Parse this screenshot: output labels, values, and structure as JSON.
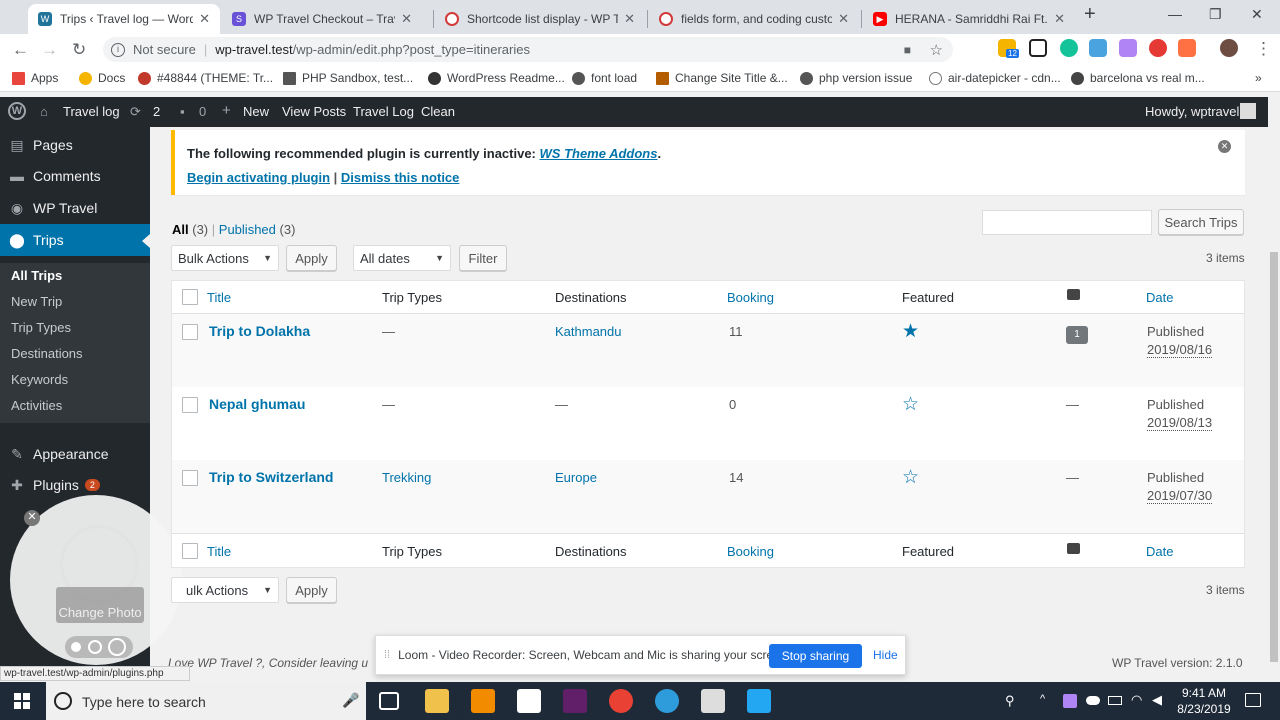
{
  "browser": {
    "tabs": [
      {
        "title": "Trips ‹ Travel log — WordPress",
        "active": true,
        "color": "#21759b"
      },
      {
        "title": "WP Travel Checkout – Travel lo",
        "active": false,
        "color": "#6a52d8"
      },
      {
        "title": "Shortcode list display - WP Tra",
        "active": false,
        "color": "#d23a3a"
      },
      {
        "title": "fields form, and coding custom",
        "active": false,
        "color": "#d23a3a"
      },
      {
        "title": "HERANA - Samriddhi Rai Ft. Ro",
        "active": false,
        "color": "#ff0000"
      }
    ],
    "new_tab": "+",
    "not_secure": "Not secure",
    "url_host": "wp-travel.test",
    "url_path": "/wp-admin/edit.php?post_type=itineraries",
    "ext_badge": "12",
    "bookmarks": [
      {
        "label": "Apps",
        "color": "#e8453c"
      },
      {
        "label": "Docs",
        "color": "#f4b400"
      },
      {
        "label": "#48844 (THEME: Tr...",
        "color": "#c0392b"
      },
      {
        "label": "PHP Sandbox, test...",
        "color": "#555555"
      },
      {
        "label": "WordPress Readme...",
        "color": "#333333"
      },
      {
        "label": "font load",
        "color": "#555555"
      },
      {
        "label": "Change Site Title &...",
        "color": "#b35c00"
      },
      {
        "label": "php version issue",
        "color": "#555555"
      },
      {
        "label": "air-datepicker - cdn...",
        "color": "#777777"
      },
      {
        "label": "barcelona vs real m...",
        "color": "#444444"
      }
    ],
    "bookmarks_more": "»"
  },
  "adminbar": {
    "site": "Travel log",
    "updates": "2",
    "comments": "0",
    "new": "New",
    "view_posts": "View Posts",
    "travel_log": "Travel Log",
    "clean": "Clean",
    "howdy": "Howdy, wptravel"
  },
  "sidebar": {
    "items": [
      {
        "label": "Pages",
        "icon": "pages-icon"
      },
      {
        "label": "Comments",
        "icon": "comments-icon"
      },
      {
        "label": "WP Travel",
        "icon": "wp-travel-icon"
      },
      {
        "label": "Trips",
        "icon": "location-pin-icon"
      }
    ],
    "submenu": [
      "All Trips",
      "New Trip",
      "Trip Types",
      "Destinations",
      "Keywords",
      "Activities"
    ],
    "appearance": "Appearance",
    "plugins": "Plugins",
    "plugins_badge": "2",
    "change_photo": "Change Photo"
  },
  "notice": {
    "text": "The following recommended plugin is currently inactive:",
    "plugin": "WS Theme Addons",
    "period": ".",
    "begin": "Begin activating plugin",
    "sep": "|",
    "dismiss": "Dismiss this notice"
  },
  "filters": {
    "all": "All",
    "all_count": "(3)",
    "sep": "|",
    "published": "Published",
    "published_count": "(3)",
    "search_button": "Search Trips",
    "bulk_actions": "Bulk Actions",
    "bulk_actions_bottom": "ulk Actions",
    "apply": "Apply",
    "all_dates": "All dates",
    "filter": "Filter",
    "items_count": "3 items"
  },
  "table": {
    "columns": [
      "Title",
      "Trip Types",
      "Destinations",
      "Booking",
      "Featured",
      "Date"
    ],
    "rows": [
      {
        "title": "Trip to Dolakha",
        "trip_types": "—",
        "destinations": "Kathmandu",
        "booking": "11",
        "featured": true,
        "comments": "1",
        "status": "Published",
        "date": "2019/08/16"
      },
      {
        "title": "Nepal ghumau",
        "trip_types": "—",
        "destinations": "—",
        "booking": "0",
        "featured": false,
        "comments": "—",
        "status": "Published",
        "date": "2019/08/13"
      },
      {
        "title": "Trip to Switzerland",
        "trip_types": "Trekking",
        "destinations": "Europe",
        "booking": "14",
        "featured": false,
        "comments": "—",
        "status": "Published",
        "date": "2019/07/30"
      }
    ]
  },
  "footer": {
    "love_text": "Love WP Travel ?, Consider leaving u",
    "version": "WP Travel version: 2.1.0",
    "status_url": "wp-travel.test/wp-admin/plugins.php"
  },
  "loom": {
    "text": "Loom - Video Recorder: Screen, Webcam and Mic is sharing your screen.",
    "stop": "Stop sharing",
    "hide": "Hide"
  },
  "taskbar": {
    "search": "Type here to search",
    "time": "9:41 AM",
    "date": "8/23/2019"
  }
}
